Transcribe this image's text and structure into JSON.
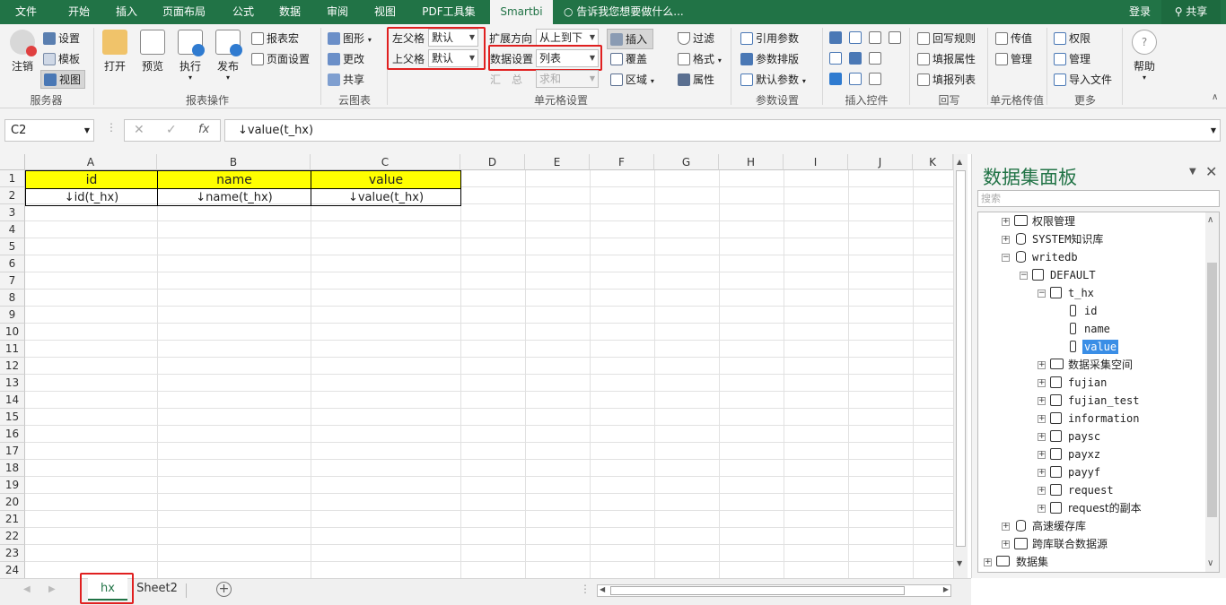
{
  "tabs": [
    "文件",
    "开始",
    "插入",
    "页面布局",
    "公式",
    "数据",
    "审阅",
    "视图",
    "PDF工具集",
    "Smartbi"
  ],
  "tell_me": "告诉我您想要做什么...",
  "login": "登录",
  "share": "共享",
  "ribbon": {
    "server": {
      "logout": "注销",
      "settings": "设置",
      "template": "模板",
      "view": "视图",
      "label": "服务器"
    },
    "report": {
      "open": "打开",
      "preview": "预览",
      "execute": "执行",
      "publish": "发布",
      "report_macro": "报表宏",
      "page_setup": "页面设置",
      "label": "报表操作"
    },
    "cloud": {
      "chart": "图形",
      "change": "更改",
      "share": "共享",
      "label": "云图表"
    },
    "cell": {
      "left_parent": "左父格",
      "left_val": "默认",
      "top_parent": "上父格",
      "top_val": "默认",
      "expand_dir": "扩展方向",
      "expand_val": "从上到下",
      "data_setting": "数据设置",
      "data_val": "列表",
      "summary": "汇　总",
      "summary_val": "求和",
      "insert": "插入",
      "cover": "覆盖",
      "region": "区域",
      "filter": "过滤",
      "format": "格式",
      "attr": "属性",
      "label": "单元格设置"
    },
    "param": {
      "ref_param": "引用参数",
      "layout": "参数排版",
      "default_param": "默认参数",
      "label": "参数设置"
    },
    "controls": {
      "label": "插入控件"
    },
    "writeback": {
      "rule": "回写规则",
      "fill_attr": "填报属性",
      "fill_list": "填报列表",
      "label": "回写"
    },
    "cellwb": {
      "pass": "传值",
      "manage": "管理",
      "label": "单元格传值"
    },
    "more": {
      "perm": "权限",
      "manage": "管理",
      "import": "导入文件",
      "label": "更多"
    },
    "help": "帮助"
  },
  "namebox": "C2",
  "formula": "↓value(t_hx)",
  "columns": [
    "A",
    "B",
    "C",
    "D",
    "E",
    "F",
    "G",
    "H",
    "I",
    "J",
    "K"
  ],
  "rows": [
    "1",
    "2",
    "3",
    "4",
    "5",
    "6",
    "7",
    "8",
    "9",
    "10",
    "11",
    "12",
    "13",
    "14",
    "15",
    "16",
    "17",
    "18",
    "19",
    "20",
    "21",
    "22",
    "23",
    "24"
  ],
  "cells": {
    "a1": "id",
    "b1": "name",
    "c1": "value",
    "a2": "↓id(t_hx)",
    "b2": "↓name(t_hx)",
    "c2": "↓value(t_hx)"
  },
  "sheets": [
    "hx",
    "Sheet2"
  ],
  "panel": {
    "title": "数据集面板",
    "search_placeholder": "搜索",
    "tree": [
      "权限管理",
      "SYSTEM知识库",
      "writedb",
      "DEFAULT",
      "t_hx",
      "id",
      "name",
      "value",
      "数据采集空间",
      "fujian",
      "fujian_test",
      "information",
      "paysc",
      "payxz",
      "payyf",
      "request",
      "request的副本",
      "高速缓存库",
      "跨库联合数据源",
      "数据集"
    ]
  },
  "colors": {
    "accent": "#217346",
    "highlight": "#ffff00",
    "red": "#e02020",
    "select": "#3a8ee6"
  }
}
